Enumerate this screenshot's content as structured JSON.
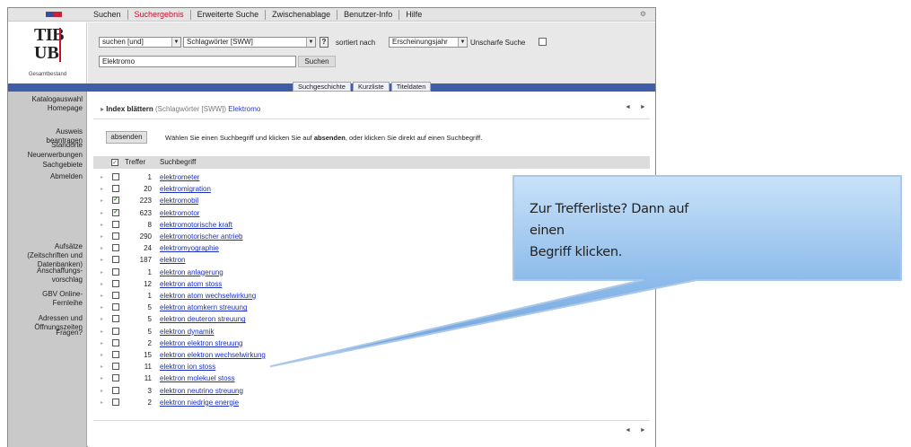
{
  "topnav": {
    "tabs": [
      "Suchen",
      "Suchergebnis",
      "Erweiterte Suche",
      "Zwischenablage",
      "Benutzer-Info",
      "Hilfe"
    ],
    "active_index": 1,
    "settings_glyph": "⚙"
  },
  "logo": {
    "line1": "TIB",
    "line2": "UB",
    "subtitle": "Gesamtbestand",
    "brand_color": "#c4122f"
  },
  "search": {
    "operator_value": "suchen [und]",
    "field_value": "Schlagwörter [SWW]",
    "help_label": "?",
    "sort_label": "sortiert nach",
    "sort_value": "Erscheinungsjahr",
    "fuzzy_label": "Unscharfe Suche",
    "query_value": "Elektromo",
    "search_button": "Suchen"
  },
  "view_tabs": [
    "Suchgeschichte",
    "Kurzliste",
    "Titeldaten"
  ],
  "sidebar": {
    "items": [
      "Katalogauswahl",
      "Homepage",
      "Ausweis\nbeantragen",
      "Standorte",
      "Neuerwerbungen",
      "Sachgebiete",
      "Abmelden",
      "Aufsätze\n(Zeitschriften und\nDatenbanken)",
      "Anschaffungs-\nvorschlag",
      "GBV Online-\nFernleihe",
      "Adressen und\nÖffnungszeiten",
      "Fragen?"
    ]
  },
  "index": {
    "title_bold": "Index blättern",
    "title_field": "(Schlagwörter [SWW])",
    "title_term": "Elektromo",
    "nav_arrows": "◄ ►"
  },
  "action": {
    "absenden_button": "absenden",
    "instr_before": "Wählen Sie einen Suchbegriff und klicken Sie auf ",
    "instr_bold": "absenden",
    "instr_after": ", oder klicken Sie direkt auf einen Suchbegriff."
  },
  "list": {
    "header_treffer": "Treffer",
    "header_suchbegriff": "Suchbegriff",
    "header_check": "✓",
    "rows": [
      {
        "count": "1",
        "term": "elektrometer",
        "checked": false
      },
      {
        "count": "20",
        "term": "elektromigration",
        "checked": false
      },
      {
        "count": "223",
        "term": "elektromobil",
        "checked": true
      },
      {
        "count": "623",
        "term": "elektromotor",
        "checked": true
      },
      {
        "count": "8",
        "term": "elektromotorische kraft",
        "checked": false
      },
      {
        "count": "290",
        "term": "elektromotorischer antrieb",
        "checked": false
      },
      {
        "count": "24",
        "term": "elektromyographie",
        "checked": false
      },
      {
        "count": "187",
        "term": "elektron",
        "checked": false
      },
      {
        "count": "1",
        "term": "elektron anlagerung",
        "checked": false
      },
      {
        "count": "12",
        "term": "elektron atom stoss",
        "checked": false
      },
      {
        "count": "1",
        "term": "elektron atom wechselwirkung",
        "checked": false
      },
      {
        "count": "5",
        "term": "elektron atomkern streuung",
        "checked": false
      },
      {
        "count": "5",
        "term": "elektron deuteron streuung",
        "checked": false
      },
      {
        "count": "5",
        "term": "elektron dynamik",
        "checked": false
      },
      {
        "count": "2",
        "term": "elektron elektron streuung",
        "checked": false
      },
      {
        "count": "15",
        "term": "elektron elektron wechselwirkung",
        "checked": false
      },
      {
        "count": "11",
        "term": "elektron ion stoss",
        "checked": false
      },
      {
        "count": "11",
        "term": "elektron molekuel stoss",
        "checked": false
      },
      {
        "count": "3",
        "term": "elektron neutrino streuung",
        "checked": false
      },
      {
        "count": "2",
        "term": "elektron niedrige energie",
        "checked": false
      }
    ]
  },
  "callout": {
    "line1": "Zur Trefferliste? Dann auf einen",
    "line2": "Begriff klicken.",
    "fill_color": "#7aaee4"
  }
}
